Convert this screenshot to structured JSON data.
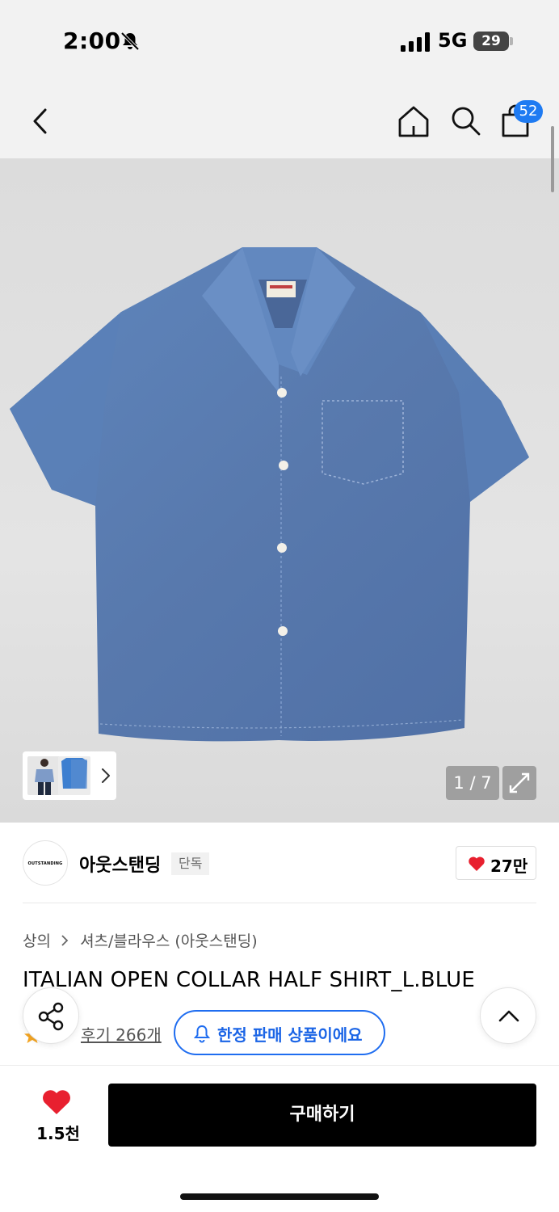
{
  "status_bar": {
    "time": "2:00",
    "network": "5G",
    "battery": "29"
  },
  "header": {
    "cart_count": "52"
  },
  "gallery": {
    "page_counter": "1 / 7",
    "shirt_color": "#5a7fb5"
  },
  "brand": {
    "logo_text": "OUTSTANDING",
    "name": "아웃스탠딩",
    "badge": "단독",
    "likes": "27만"
  },
  "breadcrumb": {
    "category": "상의",
    "subcategory": "셔츠/블라우스 (아웃스탠딩)"
  },
  "product": {
    "title": "ITALIAN OPEN COLLAR HALF SHIRT_L.BLUE",
    "reviews": "후기 266개",
    "limited_notice": "한정 판매 상품이에요"
  },
  "bottom_bar": {
    "wish_count": "1.5천",
    "buy_label": "구매하기"
  },
  "colors": {
    "accent_blue": "#1f6df0",
    "heart_red": "#e8202f"
  }
}
